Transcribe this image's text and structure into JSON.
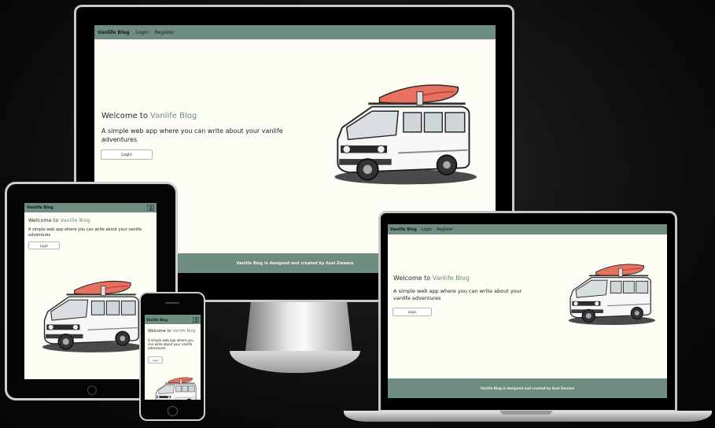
{
  "brand": "Vanlife Blog",
  "nav": {
    "login": "Login",
    "register": "Register"
  },
  "hero": {
    "welcome_prefix": "Welcome to ",
    "welcome_highlight": "Vanlife Blog",
    "tagline": "A simple web app where you can write about your vanlife adventures",
    "login_button": "Login"
  },
  "footer": {
    "text": "Vanlife Blog is designed and created by Axel Zwaans"
  },
  "colors": {
    "navbar": "#6e8c80",
    "page_bg": "#fdfdf5",
    "van_roof_kayak": "#e8705e"
  },
  "icons": [
    "hamburger-menu-icon",
    "camper-van-illustration"
  ]
}
